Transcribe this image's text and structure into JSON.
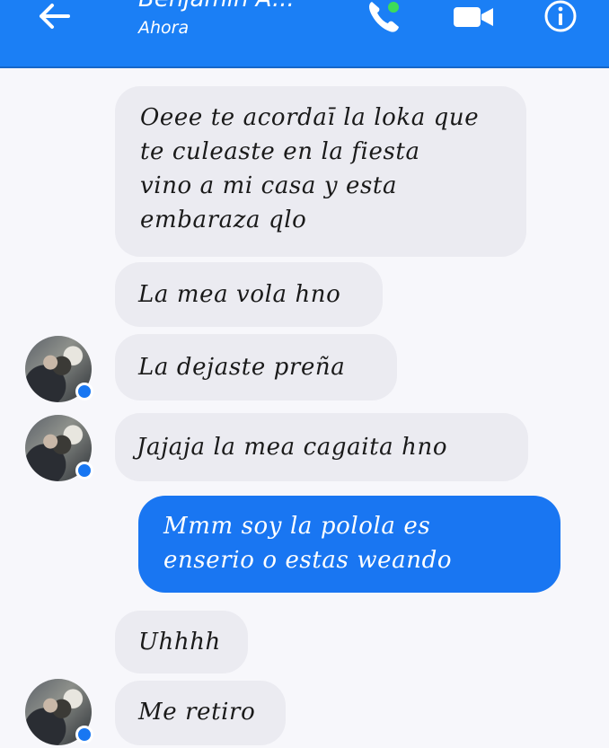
{
  "header": {
    "contact_name": "Benjamin A...",
    "status": "Ahora",
    "icons": [
      "back-arrow-icon",
      "phone-icon",
      "video-camera-icon",
      "info-icon"
    ]
  },
  "colors": {
    "header_bg": "#1b7ff5",
    "incoming_bubble": "#ebebf1",
    "outgoing_bubble": "#1976f2",
    "background": "#f7f7fb"
  },
  "messages": [
    {
      "direction": "in",
      "text": "Oeee te acordaī la loka que\nte culeaste en la fiesta\nvino a mi casa y esta\nembaraza qlo"
    },
    {
      "direction": "in",
      "text": "La mea vola hno"
    },
    {
      "direction": "in",
      "text": "La dejaste preña"
    },
    {
      "direction": "in",
      "text": "Jajaja la mea cagaita hno"
    },
    {
      "direction": "out",
      "text": "Mmm soy la polola es\nenserio o estas weando"
    },
    {
      "direction": "in",
      "text": "Uhhhh"
    },
    {
      "direction": "in",
      "text": "Me retiro"
    }
  ]
}
